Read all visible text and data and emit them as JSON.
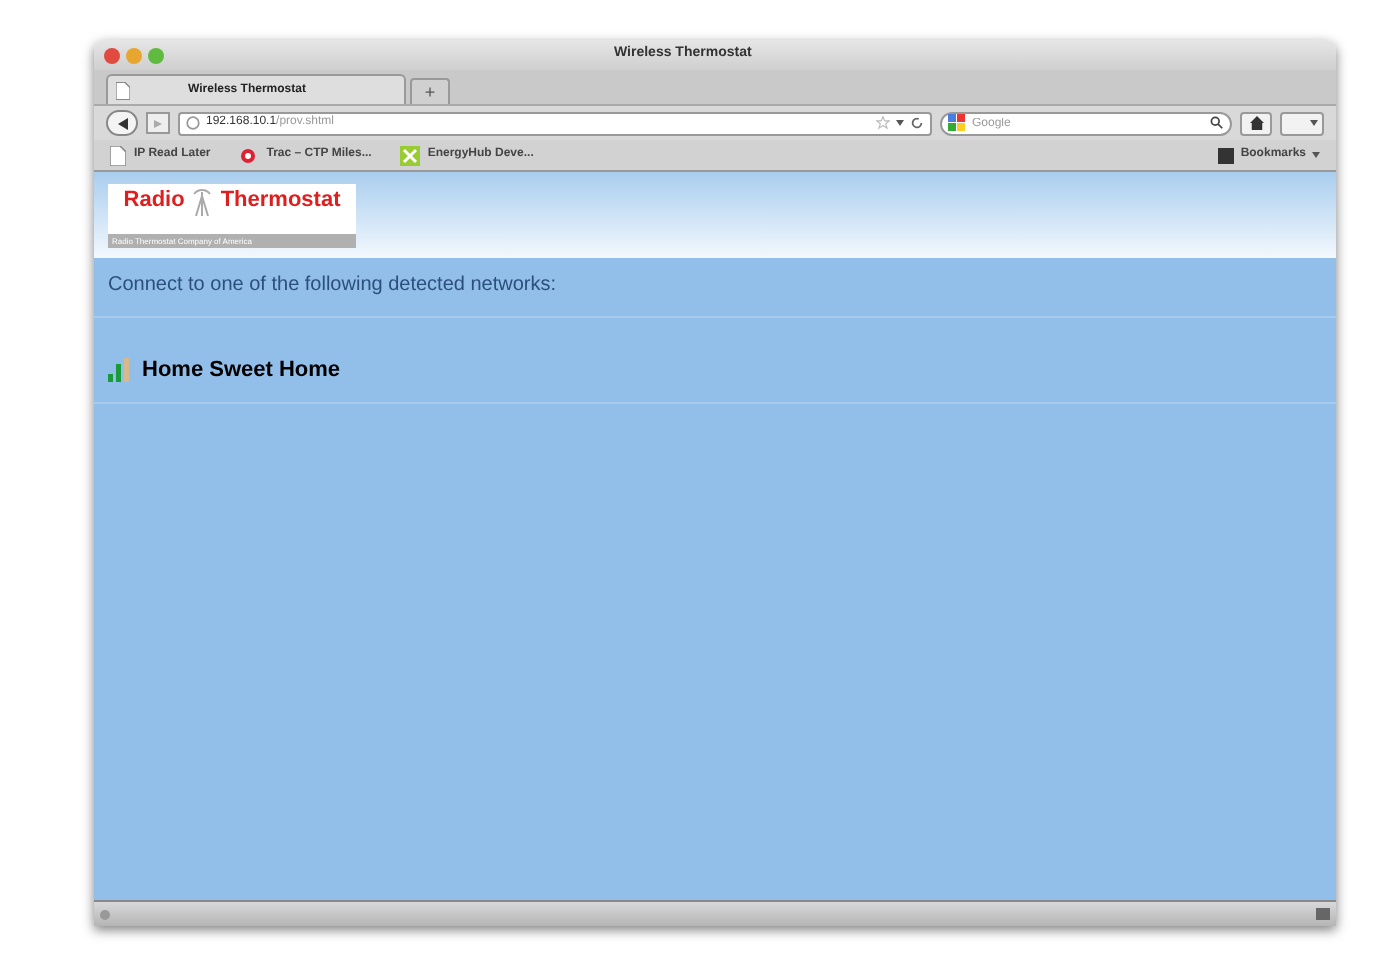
{
  "window": {
    "title": "Wireless Thermostat"
  },
  "tabs": [
    {
      "label": "Wireless Thermostat",
      "selected": true
    }
  ],
  "new_tab": {
    "label": "+"
  },
  "address_bar": {
    "host": "192.168.10.1",
    "path": "/prov.shtml"
  },
  "search": {
    "placeholder": "Google"
  },
  "bookmarks": [
    {
      "label": "IP Read Later",
      "kind": "page"
    },
    {
      "label": "Trac – CTP Miles...",
      "kind": "bug"
    },
    {
      "label": "EnergyHub Deve...",
      "kind": "leaf"
    }
  ],
  "bookmarks_menu": {
    "label": "Bookmarks"
  },
  "logo": {
    "left": "Radio",
    "right": "Thermostat",
    "tagline": "Radio Thermostat Company of America"
  },
  "prompt": "Connect to one of the following detected networks:",
  "networks": [
    {
      "name": "Home Sweet Home"
    }
  ]
}
